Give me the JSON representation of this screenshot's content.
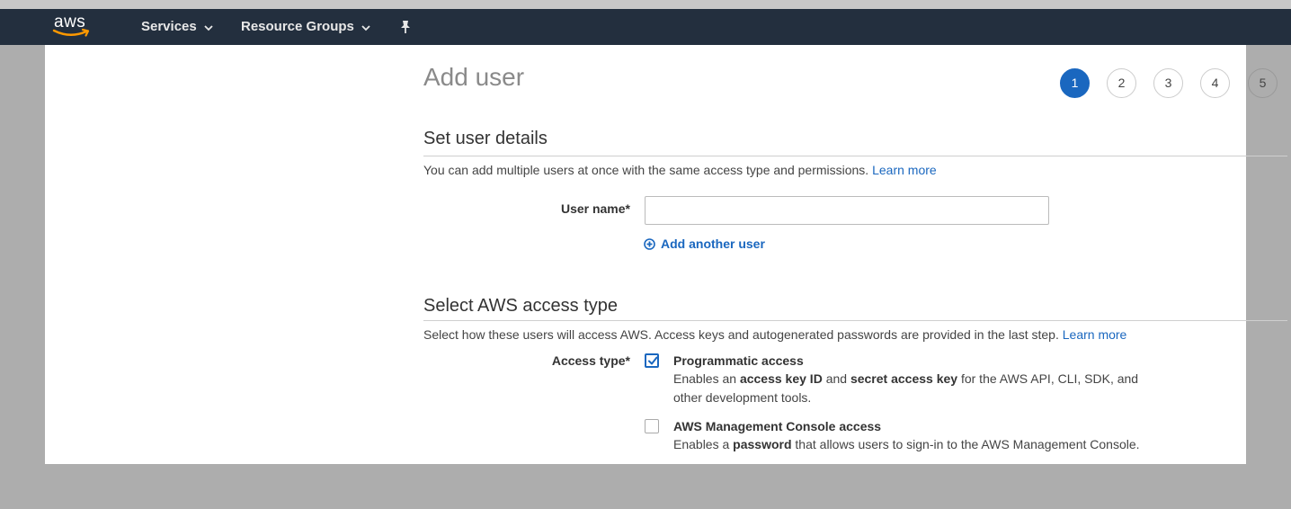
{
  "navbar": {
    "logo_text": "aws",
    "services_label": "Services",
    "resource_groups_label": "Resource Groups"
  },
  "page": {
    "title": "Add user"
  },
  "steps": [
    "1",
    "2",
    "3",
    "4",
    "5"
  ],
  "current_step": 1,
  "user_details": {
    "heading": "Set user details",
    "description": "You can add multiple users at once with the same access type and permissions.",
    "learn_more": "Learn more",
    "user_name_label": "User name*",
    "user_name_value": "",
    "add_another_label": "Add another user"
  },
  "access_type": {
    "heading": "Select AWS access type",
    "description": "Select how these users will access AWS. Access keys and autogenerated passwords are provided in the last step.",
    "learn_more": "Learn more",
    "label": "Access type*",
    "programmatic": {
      "title": "Programmatic access",
      "checked": true,
      "desc_pre": "Enables an",
      "desc_b1": "access key ID",
      "desc_mid": "and",
      "desc_b2": "secret access key",
      "desc_post": "for the AWS API, CLI, SDK, and other development tools."
    },
    "console": {
      "title": "AWS Management Console access",
      "checked": false,
      "desc_pre": "Enables a",
      "desc_b1": "password",
      "desc_post": "that allows users to sign-in to the AWS Management Console."
    }
  },
  "colors": {
    "navbar": "#232f3e",
    "accent": "#1a67bf",
    "logo_smile": "#ff9900"
  }
}
